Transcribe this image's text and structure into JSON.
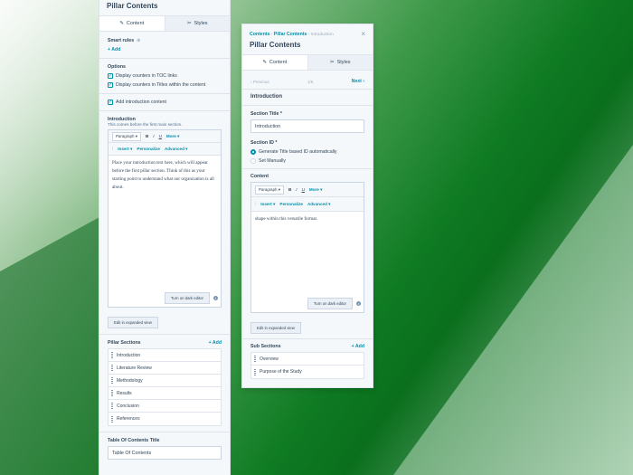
{
  "left_panel": {
    "title": "Pillar Contents",
    "tabs": [
      {
        "label": "Content"
      },
      {
        "label": "Styles"
      }
    ],
    "smart_rules": {
      "label": "Smart rules",
      "add": "+ Add"
    },
    "options": {
      "label": "Options",
      "checkboxes": [
        {
          "label": "Display counters in TOC links"
        },
        {
          "label": "Display counters in Titles within the content"
        }
      ]
    },
    "add_intro": {
      "label": "Add introduction content"
    },
    "introduction": {
      "label": "Introduction",
      "help": "This comes before the first main section.",
      "toolbar": {
        "paragraph": "Paragraph",
        "bold": "B",
        "italic": "I",
        "underline": "U",
        "more": "More",
        "insert": "Insert",
        "personalize": "Personalize",
        "advanced": "Advanced"
      },
      "body": "Place your introduction text here, which will appear before the first pillar section. Think of this as your starting point to understand what our organization is all about.",
      "dark_editor": "Turn on dark editor",
      "expanded_view": "Edit in expanded view"
    },
    "pillar_sections": {
      "label": "Pillar Sections",
      "add": "+ Add",
      "items": [
        "Introduction",
        "Literature Review",
        "Methodology",
        "Results",
        "Conclusion",
        "References"
      ]
    },
    "toc_title": {
      "label": "Table Of Contents Title",
      "value": "Table Of Contents"
    }
  },
  "right_panel": {
    "breadcrumb": [
      "Contents",
      "Pillar Contents",
      "Introduction"
    ],
    "title": "Pillar Contents",
    "tabs": [
      {
        "label": "Content"
      },
      {
        "label": "Styles"
      }
    ],
    "nav": {
      "previous": "Previous",
      "position": "1/6",
      "next": "Next"
    },
    "section_heading": "Introduction",
    "section_title": {
      "label": "Section Title *",
      "value": "Introduction"
    },
    "section_id": {
      "label": "Section ID *",
      "options": [
        {
          "label": "Generate Title based ID automatically",
          "selected": true
        },
        {
          "label": "Set Manually",
          "selected": false
        }
      ]
    },
    "content": {
      "label": "Content",
      "toolbar": {
        "paragraph": "Paragraph",
        "bold": "B",
        "italic": "I",
        "underline": "U",
        "more": "More",
        "insert": "Insert",
        "personalize": "Personalize",
        "advanced": "Advanced"
      },
      "body": "shape within this versatile format.",
      "dark_editor": "Turn on dark editor",
      "expanded_view": "Edit in expanded view"
    },
    "sub_sections": {
      "label": "Sub Sections",
      "add": "+ Add",
      "items": [
        "Overview",
        "Purpose of the Study"
      ]
    }
  },
  "colors": {
    "accent": "#0091ae",
    "text": "#33475b",
    "panel_bg": "#f5f8fa",
    "border": "#dfe3eb"
  }
}
